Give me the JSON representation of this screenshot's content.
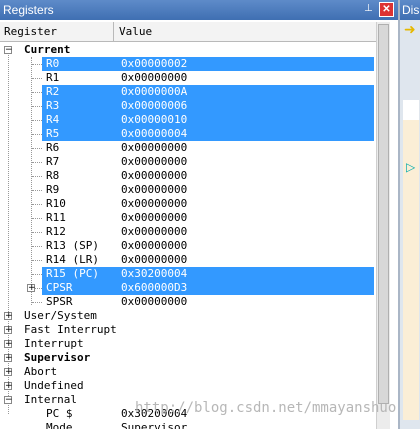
{
  "window": {
    "title": "Registers",
    "pin_icon": "pin-icon",
    "close_icon": "close-icon"
  },
  "columns": {
    "register": "Register",
    "value": "Value"
  },
  "tree": {
    "current": {
      "label": "Current"
    },
    "registers": [
      {
        "name": "R0",
        "value": "0x00000002",
        "selected": true
      },
      {
        "name": "R1",
        "value": "0x00000000",
        "selected": false
      },
      {
        "name": "R2",
        "value": "0x0000000A",
        "selected": true
      },
      {
        "name": "R3",
        "value": "0x00000006",
        "selected": true
      },
      {
        "name": "R4",
        "value": "0x00000010",
        "selected": true
      },
      {
        "name": "R5",
        "value": "0x00000004",
        "selected": true
      },
      {
        "name": "R6",
        "value": "0x00000000",
        "selected": false
      },
      {
        "name": "R7",
        "value": "0x00000000",
        "selected": false
      },
      {
        "name": "R8",
        "value": "0x00000000",
        "selected": false
      },
      {
        "name": "R9",
        "value": "0x00000000",
        "selected": false
      },
      {
        "name": "R10",
        "value": "0x00000000",
        "selected": false
      },
      {
        "name": "R11",
        "value": "0x00000000",
        "selected": false
      },
      {
        "name": "R12",
        "value": "0x00000000",
        "selected": false
      },
      {
        "name": "R13 (SP)",
        "value": "0x00000000",
        "selected": false
      },
      {
        "name": "R14 (LR)",
        "value": "0x00000000",
        "selected": false
      },
      {
        "name": "R15 (PC)",
        "value": "0x30200004",
        "selected": true
      },
      {
        "name": "CPSR",
        "value": "0x600000D3",
        "selected": true
      },
      {
        "name": "SPSR",
        "value": "0x00000000",
        "selected": false
      }
    ],
    "groups": [
      {
        "label": "User/System",
        "bold": false
      },
      {
        "label": "Fast Interrupt",
        "bold": false
      },
      {
        "label": "Interrupt",
        "bold": false
      },
      {
        "label": "Supervisor",
        "bold": true
      },
      {
        "label": "Abort",
        "bold": false
      },
      {
        "label": "Undefined",
        "bold": false
      },
      {
        "label": "Internal",
        "bold": false
      }
    ],
    "internal": [
      {
        "name": "PC $",
        "value": "0x30200004"
      },
      {
        "name": "Mode",
        "value": "Supervisor"
      }
    ]
  },
  "right_pane": {
    "title": "Dis"
  },
  "watermark": "http://blog.csdn.net/mmayanshuo",
  "colors": {
    "selection": "#3399ff",
    "titlebar": "#4a7bbd"
  }
}
